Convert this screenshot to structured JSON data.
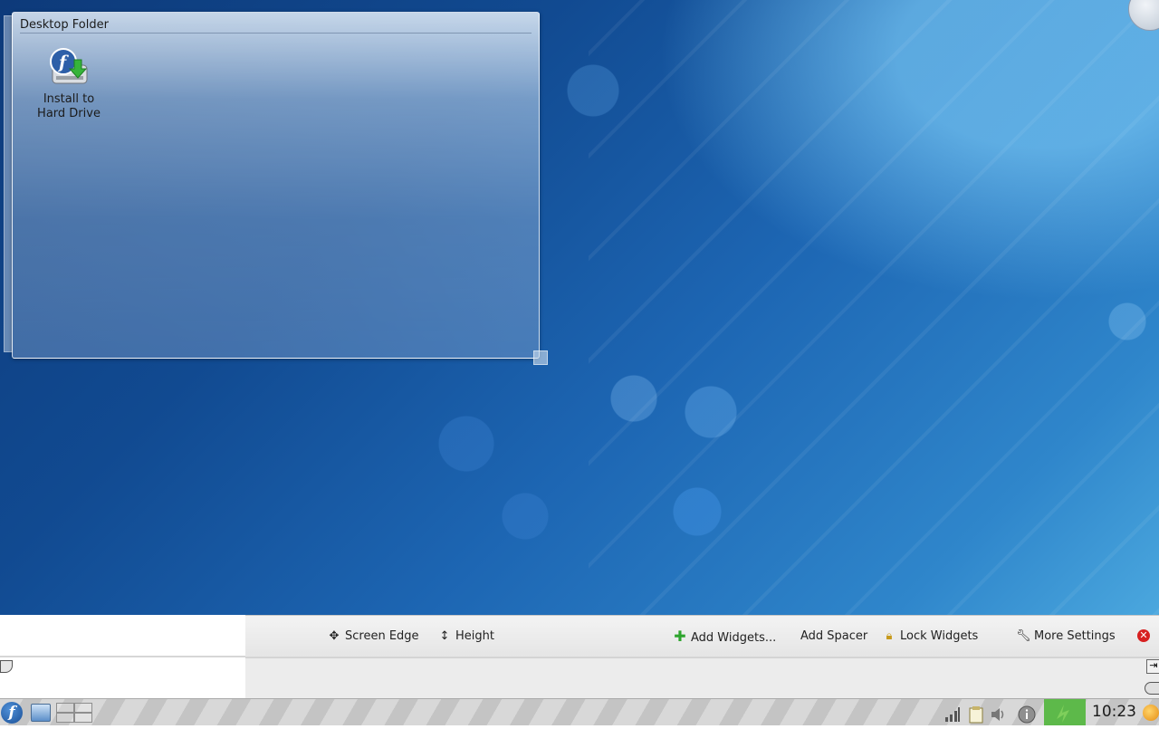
{
  "folder_view": {
    "title": "Desktop Folder",
    "icons": [
      {
        "label_line1": "Install to",
        "label_line2": "Hard Drive",
        "icon": "fedora-install-icon"
      }
    ]
  },
  "panel_controller": {
    "buttons": {
      "screen_edge": "Screen Edge",
      "height": "Height",
      "add_widgets": "Add Widgets...",
      "add_spacer": "Add Spacer",
      "lock_widgets": "Lock Widgets",
      "more_settings": "More Settings"
    }
  },
  "panel": {
    "clock": "10:23"
  },
  "colors": {
    "close_button": "#d72020",
    "battery_accent": "#5db94a",
    "add_widgets_icon": "#2ea52e"
  }
}
